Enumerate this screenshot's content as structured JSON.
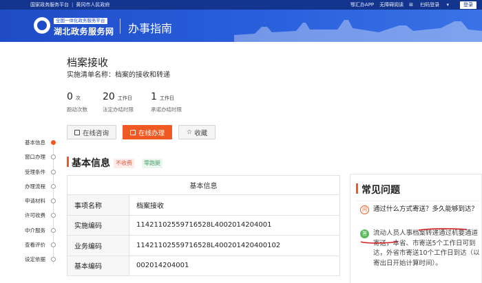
{
  "topbar": {
    "link_national": "国家政务服务平台",
    "link_city": "黄冈市人民政府",
    "app_link": "鄂汇办APP",
    "accessibility": "无障碍阅读",
    "scan_login": "扫码登录",
    "login_button": "登录"
  },
  "header": {
    "logo_subtitle": "全国一体化政务服务平台",
    "logo_name": "湖北政务服务网",
    "section_title": "办事指南"
  },
  "item": {
    "title": "档案接收",
    "list_name": "实施清单名称：档案的接收和转递"
  },
  "stats": [
    {
      "value": "0",
      "unit": "次",
      "label": "跑动次数"
    },
    {
      "value": "20",
      "unit": "工作日",
      "label": "法定办结时限"
    },
    {
      "value": "1",
      "unit": "工作日",
      "label": "承诺办结时限"
    }
  ],
  "buttons": {
    "consult": "在线咨询",
    "apply": "在线办理",
    "favorite": "收藏"
  },
  "nav": {
    "items": [
      "基本信息",
      "窗口办理",
      "受理条件",
      "办理流程",
      "申请材料",
      "许可收费",
      "中介服务",
      "查看评价",
      "设定依据"
    ],
    "active_index": 0
  },
  "section": {
    "title": "基本信息",
    "tag_fee": "不收费",
    "tag_zero": "零跑腿"
  },
  "basic_info": {
    "header": "基本信息",
    "rows": [
      {
        "key": "事项名称",
        "value": "档案接收"
      },
      {
        "key": "实施编码",
        "value": "11421102559716528L4002014204001"
      },
      {
        "key": "业务编码",
        "value": "11421102559716528L400201420400102"
      },
      {
        "key": "基本编码",
        "value": "002014204001"
      }
    ]
  },
  "faq": {
    "title": "常见问题",
    "q_badge": "问",
    "a_badge": "答",
    "question": "通过什么方式寄送？多久能够到达？",
    "answer": "流动人员人事档案转递通过机要通道寄送，本省、市寄送5个工作日可到达，外省市寄送10个工作日到达（以寄出日开始计算时间）。"
  },
  "colors": {
    "brand_blue": "#1f4cc6",
    "accent_orange": "#f05a22",
    "tag_green": "#49a06a"
  }
}
